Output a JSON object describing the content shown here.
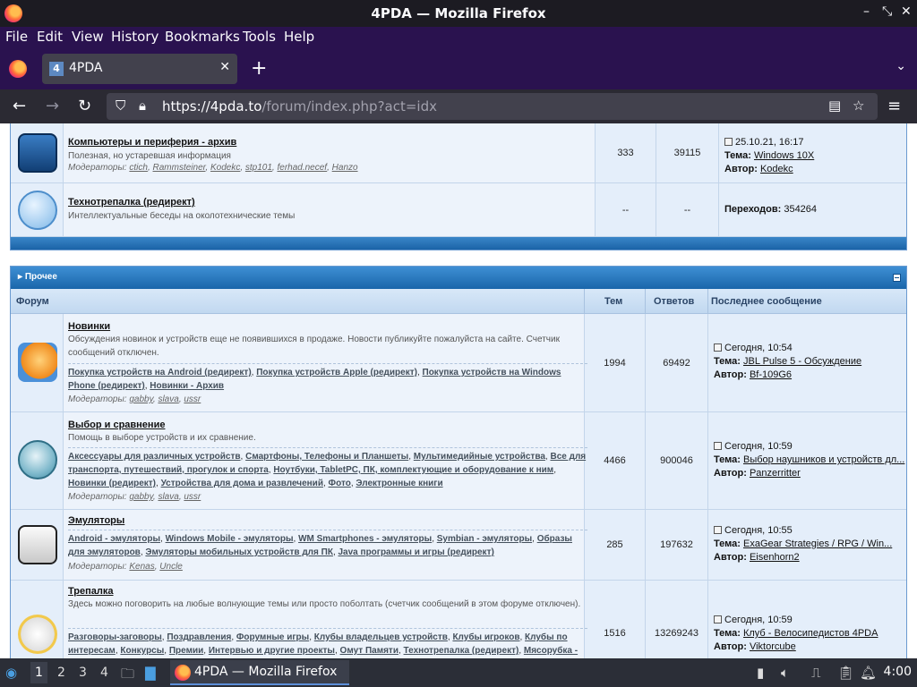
{
  "window": {
    "title": "4PDA — Mozilla Firefox"
  },
  "menu": [
    "File",
    "Edit",
    "View",
    "History",
    "Bookmarks",
    "Tools",
    "Help"
  ],
  "tab": {
    "favicon": "4",
    "label": "4PDA"
  },
  "url": {
    "host": "https://4pda.to",
    "path": "/forum/index.php?act=idx"
  },
  "top_rows": [
    {
      "name": "Компьютеры и периферия - архив",
      "desc": "Полезная, но устаревшая информация",
      "mod_label": "Модераторы:",
      "mods": [
        "ctich",
        "Rammsteiner",
        "Kodekc",
        "stp101",
        "ferhad.necef",
        "Hanzo"
      ],
      "topics": "333",
      "replies": "39115",
      "last_date": "25.10.21, 16:17",
      "last_topic_label": "Тема:",
      "last_topic": "Windows 10X",
      "last_author_label": "Автор:",
      "last_author": "Kodekc"
    },
    {
      "name": "Технотрепалка (редирект)",
      "desc": "Интеллектуальные беседы на околотехнические темы",
      "topics": "--",
      "replies": "--",
      "redirect_label": "Переходов:",
      "redirect_count": "354264"
    }
  ],
  "category": {
    "title": "Прочее",
    "col_forum": "Форум",
    "col_topics": "Тем",
    "col_replies": "Ответов",
    "col_last": "Последнее сообщение",
    "rows": [
      {
        "name": "Новинки",
        "desc": "Обсуждения новинок и устройств еще не появившихся в продаже. Новости публикуйте пожалуйста на сайте. Счетчик сообщений отключен.",
        "sub": [
          "Покупка устройств на Android (редирект)",
          "Покупка устройств Apple (редирект)",
          "Покупка устройств на Windows Phone (редирект)",
          "Новинки - Архив"
        ],
        "mod_label": "Модераторы:",
        "mods": [
          "gabby",
          "slava",
          "ussr"
        ],
        "topics": "1994",
        "replies": "69492",
        "last_date": "Сегодня, 10:54",
        "last_topic_label": "Тема:",
        "last_topic": "JBL Pulse 5 - Обсуждение",
        "last_author_label": "Автор:",
        "last_author": "Bf-109G6"
      },
      {
        "name": "Выбор и сравнение",
        "desc": "Помощь в выборе устройств и их сравнение.",
        "sub": [
          "Аксессуары для различных устройств",
          "Смартфоны, Телефоны и Планшеты",
          "Мультимедийные устройства",
          "Все для транспорта, путешествий, прогулок и спорта",
          "Ноутбуки, TabletPC, ПК, комплектующие и оборудование к ним",
          "Новинки (редирект)",
          "Устройства для дома и развлечений",
          "Фото",
          "Электронные книги"
        ],
        "mod_label": "Модераторы:",
        "mods": [
          "gabby",
          "slava",
          "ussr"
        ],
        "topics": "4466",
        "replies": "900046",
        "last_date": "Сегодня, 10:59",
        "last_topic_label": "Тема:",
        "last_topic": "Выбор наушников и устройств дл...",
        "last_author_label": "Автор:",
        "last_author": "Panzerritter"
      },
      {
        "name": "Эмуляторы",
        "sub": [
          "Android - эмуляторы",
          "Windows Mobile - эмуляторы",
          "WM Smartphones - эмуляторы",
          "Symbian - эмуляторы",
          "Образы для эмуляторов",
          "Эмуляторы мобильных устройств для ПК",
          "Java программы и игры (редирект)"
        ],
        "mod_label": "Модераторы:",
        "mods": [
          "Kenas",
          "Uncle"
        ],
        "topics": "285",
        "replies": "197632",
        "last_date": "Сегодня, 10:55",
        "last_topic_label": "Тема:",
        "last_topic": "ExaGear Strategies / RPG / Win...",
        "last_author_label": "Автор:",
        "last_author": "Eisenhorn2"
      },
      {
        "name": "Трепалка",
        "desc": "Здесь можно поговорить на любые волнующие темы или просто поболтать (счетчик сообщений в этом форуме отключен).",
        "sub": [
          "Разговоры-заговоры",
          "Поздравления",
          "Форумные игры",
          "Клубы владельцев устройств",
          "Клубы игроков",
          "Клубы по интересам",
          "Конкурсы",
          "Премии",
          "Интервью и другие проекты",
          "Омут Памяти",
          "Технотрепалка (редирект)",
          "Мясорубка -"
        ],
        "topics": "1516",
        "replies": "13269243",
        "last_date": "Сегодня, 10:59",
        "last_topic_label": "Тема:",
        "last_topic": "Клуб - Велосипедистов 4PDA",
        "last_author_label": "Автор:",
        "last_author": "Viktorcube"
      }
    ]
  },
  "taskbar": {
    "workspaces": [
      "1",
      "2",
      "3",
      "4"
    ],
    "task_label": "4PDA — Mozilla Firefox",
    "clock": "4:00"
  },
  "icons": {
    "back": "arrow-left",
    "forward": "arrow-right",
    "reload": "reload",
    "shield": "shield",
    "lock": "lock",
    "reader": "reader-view",
    "star": "star",
    "menu": "hamburger"
  }
}
